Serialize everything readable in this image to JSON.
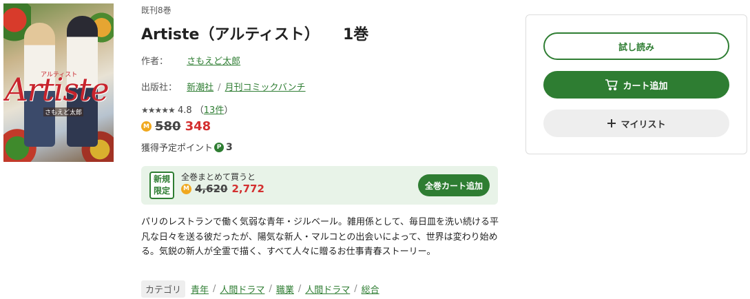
{
  "cover": {
    "title": "Artiste",
    "kana": "アルティスト",
    "author": "さもえど太郎"
  },
  "series_count": "既刊8巻",
  "title": {
    "name": "Artiste（アルティスト）",
    "volume": "1巻"
  },
  "author": {
    "label": "作者：",
    "name": "さもえど太郎"
  },
  "publisher": {
    "label": "出版社：",
    "name": "新潮社",
    "label_name": "月刊コミックバンチ"
  },
  "rating": {
    "stars": "★★★★★",
    "value": "4.8",
    "count": "13件",
    "open": "（",
    "close": "）"
  },
  "price": {
    "coin": "M",
    "original": "580",
    "sale": "348"
  },
  "points": {
    "label": "獲得予定ポイント",
    "badge": "P",
    "value": "3"
  },
  "bundle": {
    "tag_line1": "新規",
    "tag_line2": "限定",
    "caption": "全巻まとめて買うと",
    "coin": "M",
    "original": "4,620",
    "sale": "2,772",
    "button": "全巻カート追加"
  },
  "description": "パリのレストランで働く気弱な青年・ジルベール。雑用係として、毎日皿を洗い続ける平凡な日々を送る彼だったが、陽気な新人・マルコとの出会いによって、世界は変わり始める。気鋭の新人が全霊で描く、すべて人々に贈るお仕事青春ストーリー。",
  "categories": {
    "label": "カテゴリ",
    "items": [
      "青年",
      "人間ドラマ",
      "職業",
      "人間ドラマ",
      "総合"
    ]
  },
  "panel": {
    "trial": "試し読み",
    "cart": "カート追加",
    "mylist": "マイリスト"
  },
  "colors": {
    "accent": "#2e7d32",
    "price": "#d32f2f",
    "coin": "#f0a81e",
    "bundle_bg": "#e8f3e8"
  },
  "icons": {
    "cart": "cart-icon",
    "plus": "plus-icon"
  }
}
